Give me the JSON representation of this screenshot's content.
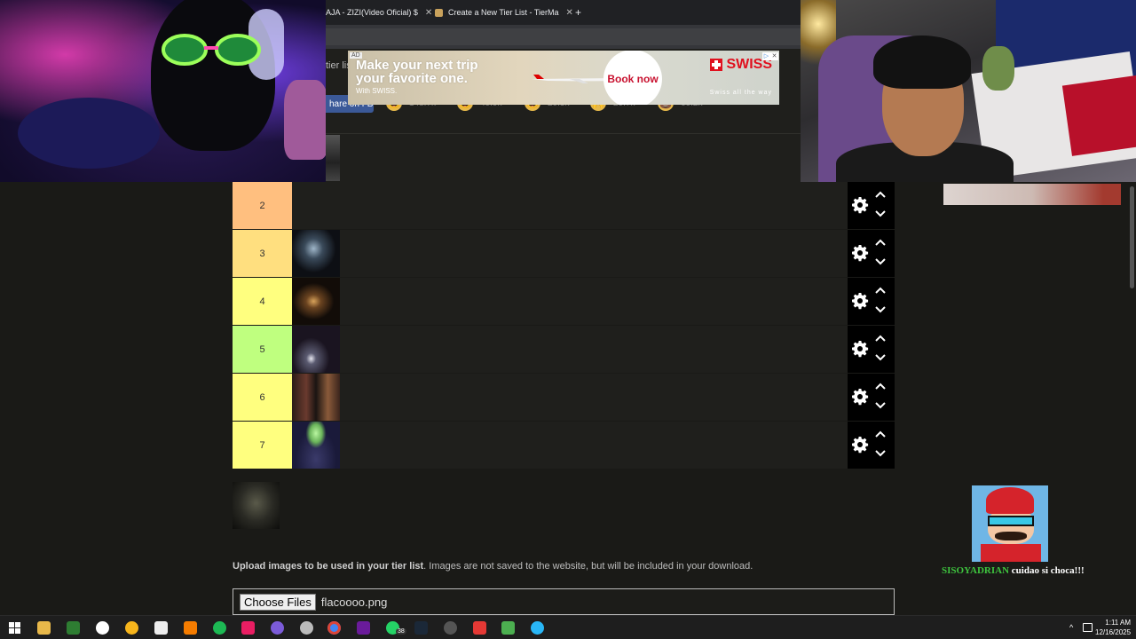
{
  "browser": {
    "tabs": [
      {
        "title": "AJA - ZIZI(Video Oficial) $",
        "close": "✕"
      },
      {
        "title": "Create a New Tier List - TierMa",
        "close": "✕"
      }
    ],
    "new_tab": "+"
  },
  "site": {
    "tier_list_fragment": "tier lis",
    "share_label": "hare on FB",
    "reactions": [
      {
        "icon": "laugh-emoji-icon",
        "glyph": "😄",
        "count": "148.7k"
      },
      {
        "icon": "grin-emoji-icon",
        "glyph": "😆",
        "count": "40.9k"
      },
      {
        "icon": "smile-emoji-icon",
        "glyph": "😅",
        "count": "20.3k"
      },
      {
        "icon": "pray-emoji-icon",
        "glyph": "🙌",
        "count": "20.7k"
      },
      {
        "icon": "poop-emoji-icon",
        "glyph": "💩",
        "count": "60.2k"
      }
    ]
  },
  "ad": {
    "tag": "AD",
    "headline": "Make your next trip your favorite one.",
    "sub": "With SWISS.",
    "button": "Book now",
    "brand": "SWISS",
    "tagline": "Swiss all the way"
  },
  "tiers": [
    {
      "label": "2",
      "color": "#ffbf7f",
      "items": 0
    },
    {
      "label": "3",
      "color": "#ffdf7f",
      "items": 1
    },
    {
      "label": "4",
      "color": "#ffff7f",
      "items": 1
    },
    {
      "label": "5",
      "color": "#bfff7f",
      "items": 1
    },
    {
      "label": "6",
      "color": "#ffff7f",
      "items": 1
    },
    {
      "label": "7",
      "color": "#ffff7f",
      "items": 1
    }
  ],
  "upload": {
    "bold": "Upload images to be used in your tier list",
    "rest": ". Images are not saved to the website, but will be included in your download.",
    "button": "Choose Files",
    "file_name": "flacoooo.png"
  },
  "chat": {
    "user": "SISOYADRIAN",
    "message": " cuidao si choca!!!"
  },
  "taskbar": {
    "time": "1:11 AM",
    "date": "12/16/2025",
    "badge": "38"
  }
}
